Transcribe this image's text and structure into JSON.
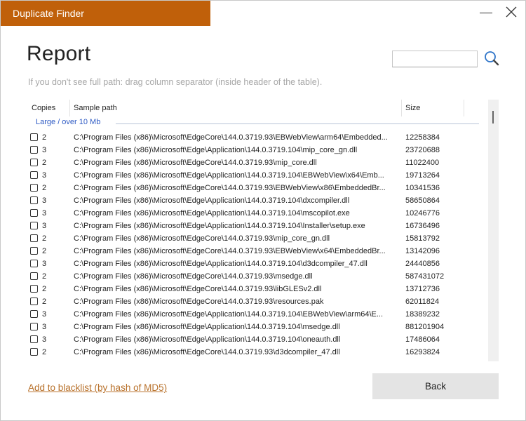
{
  "window": {
    "title": "Duplicate Finder"
  },
  "report": {
    "title": "Report",
    "hint": "If you don't see full path: drag column separator (inside header of the table).",
    "search": {
      "value": "",
      "placeholder": ""
    }
  },
  "table": {
    "headers": {
      "copies": "Copies",
      "path": "Sample path",
      "size": "Size"
    },
    "group_label": "Large / over 10 Mb",
    "rows": [
      {
        "copies": "2",
        "path": "C:\\Program Files (x86)\\Microsoft\\EdgeCore\\144.0.3719.93\\EBWebView\\arm64\\Embedded...",
        "size": "12258384"
      },
      {
        "copies": "3",
        "path": "C:\\Program Files (x86)\\Microsoft\\Edge\\Application\\144.0.3719.104\\mip_core_gn.dll",
        "size": "23720688"
      },
      {
        "copies": "2",
        "path": "C:\\Program Files (x86)\\Microsoft\\EdgeCore\\144.0.3719.93\\mip_core.dll",
        "size": "11022400"
      },
      {
        "copies": "3",
        "path": "C:\\Program Files (x86)\\Microsoft\\Edge\\Application\\144.0.3719.104\\EBWebView\\x64\\Emb...",
        "size": "19713264"
      },
      {
        "copies": "2",
        "path": "C:\\Program Files (x86)\\Microsoft\\EdgeCore\\144.0.3719.93\\EBWebView\\x86\\EmbeddedBr...",
        "size": "10341536"
      },
      {
        "copies": "3",
        "path": "C:\\Program Files (x86)\\Microsoft\\Edge\\Application\\144.0.3719.104\\dxcompiler.dll",
        "size": "58650864"
      },
      {
        "copies": "3",
        "path": "C:\\Program Files (x86)\\Microsoft\\Edge\\Application\\144.0.3719.104\\mscopilot.exe",
        "size": "10246776"
      },
      {
        "copies": "3",
        "path": "C:\\Program Files (x86)\\Microsoft\\Edge\\Application\\144.0.3719.104\\Installer\\setup.exe",
        "size": "16736496"
      },
      {
        "copies": "2",
        "path": "C:\\Program Files (x86)\\Microsoft\\EdgeCore\\144.0.3719.93\\mip_core_gn.dll",
        "size": "15813792"
      },
      {
        "copies": "2",
        "path": "C:\\Program Files (x86)\\Microsoft\\EdgeCore\\144.0.3719.93\\EBWebView\\x64\\EmbeddedBr...",
        "size": "13142096"
      },
      {
        "copies": "3",
        "path": "C:\\Program Files (x86)\\Microsoft\\Edge\\Application\\144.0.3719.104\\d3dcompiler_47.dll",
        "size": "24440856"
      },
      {
        "copies": "2",
        "path": "C:\\Program Files (x86)\\Microsoft\\EdgeCore\\144.0.3719.93\\msedge.dll",
        "size": "587431072"
      },
      {
        "copies": "2",
        "path": "C:\\Program Files (x86)\\Microsoft\\EdgeCore\\144.0.3719.93\\libGLESv2.dll",
        "size": "13712736"
      },
      {
        "copies": "2",
        "path": "C:\\Program Files (x86)\\Microsoft\\EdgeCore\\144.0.3719.93\\resources.pak",
        "size": "62011824"
      },
      {
        "copies": "3",
        "path": "C:\\Program Files (x86)\\Microsoft\\Edge\\Application\\144.0.3719.104\\EBWebView\\arm64\\E...",
        "size": "18389232"
      },
      {
        "copies": "3",
        "path": "C:\\Program Files (x86)\\Microsoft\\Edge\\Application\\144.0.3719.104\\msedge.dll",
        "size": "881201904"
      },
      {
        "copies": "3",
        "path": "C:\\Program Files (x86)\\Microsoft\\Edge\\Application\\144.0.3719.104\\oneauth.dll",
        "size": "17486064"
      },
      {
        "copies": "2",
        "path": "C:\\Program Files (x86)\\Microsoft\\EdgeCore\\144.0.3719.93\\d3dcompiler_47.dll",
        "size": "16293824"
      }
    ]
  },
  "footer": {
    "blacklist_link": "Add to blacklist (by hash of MD5)",
    "back_label": "Back"
  },
  "colors": {
    "title_bar": "#c0600a",
    "group_label": "#2f5bc4",
    "link": "#b8712b",
    "button": "#e4e4e4"
  },
  "icons": {
    "minimize": "minimize-icon",
    "close": "close-icon",
    "search": "search-icon"
  }
}
